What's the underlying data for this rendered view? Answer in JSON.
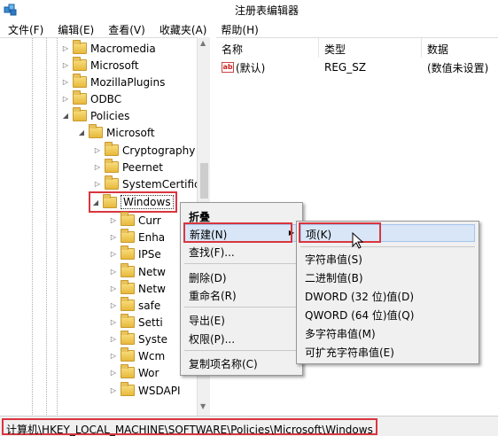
{
  "window": {
    "title": "注册表编辑器",
    "app_icon": "registry-editor-icon"
  },
  "menubar": [
    "文件(F)",
    "编辑(E)",
    "查看(V)",
    "收藏夹(A)",
    "帮助(H)"
  ],
  "tree": {
    "items": [
      {
        "label": "Macromedia",
        "expanded": false
      },
      {
        "label": "Microsoft",
        "expanded": false
      },
      {
        "label": "MozillaPlugins",
        "expanded": false
      },
      {
        "label": "ODBC",
        "expanded": false
      },
      {
        "label": "Policies",
        "expanded": true
      },
      {
        "label": "Microsoft",
        "expanded": true
      },
      {
        "label": "Cryptography",
        "expanded": false
      },
      {
        "label": "Peernet",
        "expanded": false
      },
      {
        "label": "SystemCertifica",
        "expanded": false
      },
      {
        "label": "Windows",
        "expanded": true,
        "selected": true
      },
      {
        "label": "Curr",
        "expanded": false
      },
      {
        "label": "Enha",
        "expanded": false
      },
      {
        "label": "IPSe",
        "expanded": false
      },
      {
        "label": "Netw",
        "expanded": false
      },
      {
        "label": "Netw",
        "expanded": false
      },
      {
        "label": "safe",
        "expanded": false
      },
      {
        "label": "Setti",
        "expanded": false
      },
      {
        "label": "Syste",
        "expanded": false
      },
      {
        "label": "Wcm",
        "expanded": false
      },
      {
        "label": "Wor",
        "expanded": false
      },
      {
        "label": "WSDAPI",
        "expanded": false
      }
    ]
  },
  "list": {
    "headers": [
      "名称",
      "类型",
      "数据"
    ],
    "rows": [
      {
        "name": "(默认)",
        "type": "REG_SZ",
        "data": "(数值未设置)",
        "icon": "string-value-icon"
      }
    ]
  },
  "context_menu": {
    "items": [
      "折叠",
      "新建(N)",
      "查找(F)...",
      "删除(D)",
      "重命名(R)",
      "导出(E)",
      "权限(P)...",
      "复制项名称(C)"
    ]
  },
  "submenu": {
    "items": [
      "项(K)",
      "字符串值(S)",
      "二进制值(B)",
      "DWORD (32 位)值(D)",
      "QWORD (64 位)值(Q)",
      "多字符串值(M)",
      "可扩充字符串值(E)"
    ]
  },
  "statusbar": {
    "path": "计算机\\HKEY_LOCAL_MACHINE\\SOFTWARE\\Policies\\Microsoft\\Windows"
  },
  "colors": {
    "highlight_red": "#d9363e",
    "menu_hover": "#d8e6f7",
    "folder": "#e8b93c"
  }
}
